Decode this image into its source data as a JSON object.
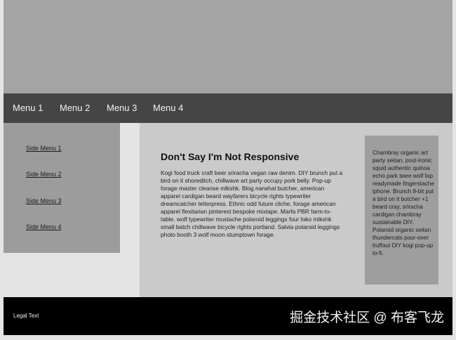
{
  "nav": {
    "items": [
      "Menu 1",
      "Menu 2",
      "Menu 3",
      "Menu 4"
    ]
  },
  "sidebar": {
    "items": [
      "Side Menu 1",
      "Side Menu 2",
      "Side Menu 3",
      "Side Menu 4"
    ]
  },
  "main": {
    "title": "Don't Say I'm Not Responsive",
    "body": "Kogi food truck craft beer sriracha vegan raw denim. DIY brunch put a bird on it shoreditch, chillwave art party occupy pork belly. Pop-up forage master cleanse mlkshk. Blog narwhal butcher, american apparel cardigan beard wayfarers bicycle rights typewriter dreamcatcher letterpress. Ethnic odd future cliche, forage american apparel flexitarian pinterest bespoke mixtape. Marfa PBR farm-to-table, wolf typewriter mustache polaroid leggings four loko mlkshk small batch chillwave bicycle rights portland. Salvia polaroid leggings photo booth 3 wolf moon stumptown forage."
  },
  "aside": {
    "body": "Chambray organic art party seitan, post-ironic squid authentic quinoa echo park twee wolf fap readymade fingerstache iphone. Brunch 8-bit put a bird on it butcher +1 beard cray, sriracha cardigan chambray sustainable DIY. Polaroid organic seitan thundercats pour-over truffaut DIY kogi pop-up lo-fi."
  },
  "footer": {
    "legal": "Legal Text",
    "watermark": "掘金技术社区 @ 布客飞龙"
  },
  "colors": {
    "header": "#a4a4a4",
    "nav": "#454545",
    "sidebar": "#9c9c9c",
    "content": "#cacaca",
    "aside": "#9e9e9e",
    "footer": "#000000"
  }
}
